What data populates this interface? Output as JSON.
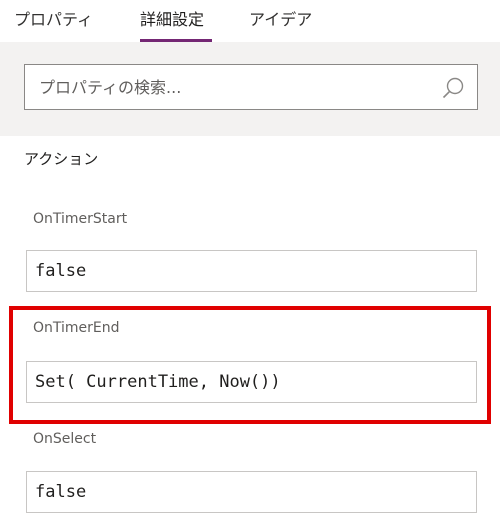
{
  "tabs": [
    {
      "label": "プロパティ",
      "active": false
    },
    {
      "label": "詳細設定",
      "active": true
    },
    {
      "label": "アイデア",
      "active": false
    }
  ],
  "search": {
    "placeholder": "プロパティの検索...",
    "value": "",
    "icon": "search-icon"
  },
  "section": {
    "title": "アクション"
  },
  "properties": [
    {
      "name": "OnTimerStart",
      "value": "false"
    },
    {
      "name": "OnTimerEnd",
      "value": "Set( CurrentTime, Now())",
      "highlighted": true
    },
    {
      "name": "OnSelect",
      "value": "false"
    }
  ],
  "colors": {
    "accent": "#742774",
    "highlight": "#e00000",
    "search_band": "#f3f2f1"
  }
}
